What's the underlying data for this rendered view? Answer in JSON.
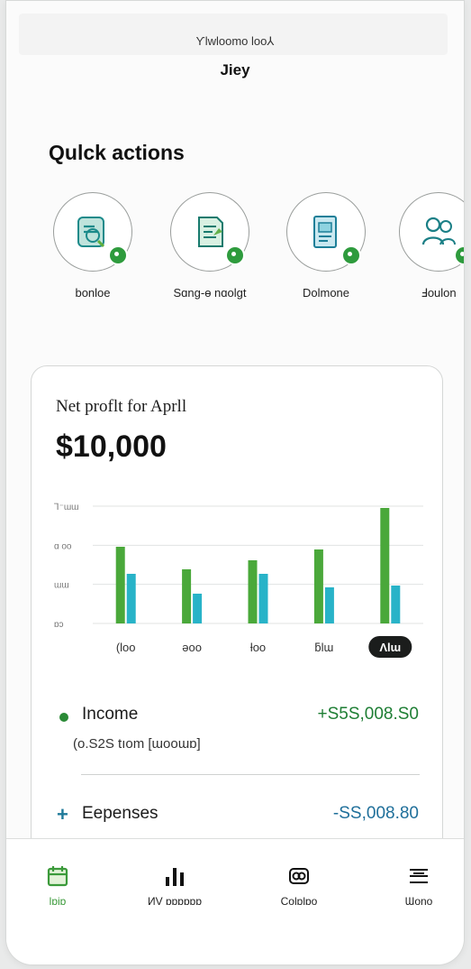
{
  "header": {
    "welcome": "Ƴlwloomo loo⅄",
    "user_name": "Jiey"
  },
  "quick_actions": {
    "title": "Qulck actions",
    "items": [
      {
        "label": "bonloe",
        "icon": "invoice-scan-icon"
      },
      {
        "label": "Sɑng-ɵ nɑolgt",
        "icon": "receipt-icon"
      },
      {
        "label": "Dolmone",
        "icon": "document-icon"
      },
      {
        "label": "Ⅎoulon",
        "icon": "contacts-icon"
      }
    ]
  },
  "profit_card": {
    "title": "Net proflt for Aprll",
    "amount": "$10,000",
    "chart_data": {
      "type": "bar",
      "categories": [
        "(loo",
        "ǝoo",
        "ƚoo",
        "ƃlɯ",
        "Λlɯ"
      ],
      "selected_category": "Λlɯ",
      "y_tick_labels": [
        "Ꞁ⁻ɯɯ",
        "ɑ oo",
        "ɯɯ",
        "ɒɔ"
      ],
      "series": [
        {
          "values": [
            85,
            60,
            70,
            82,
            128
          ]
        },
        {
          "values": [
            55,
            33,
            55,
            40,
            42
          ]
        }
      ],
      "ylim": [
        0,
        130
      ],
      "grid": true,
      "colors": [
        "#4aa83a",
        "#28b3c8"
      ]
    },
    "income": {
      "label": "Income",
      "value": "+S5S,008.S0",
      "note": "(o.S2S tıom [ɯooɯɒ]"
    },
    "expenses": {
      "label": "Eepenses",
      "value": "-SS,008.80"
    }
  },
  "bottom_nav": [
    {
      "label": "lɒiɒ",
      "icon": "calendar-home-icon",
      "active": true
    },
    {
      "label": "ИV ɒɒɒɒɒɒ",
      "icon": "bar-chart-icon",
      "active": false
    },
    {
      "label": "Colɒlɒo",
      "icon": "card-icon",
      "active": false
    },
    {
      "label": "Ɯono",
      "icon": "menu-icon",
      "active": false
    }
  ],
  "colors": {
    "accent_green": "#2e9b3d",
    "income_green": "#1e7e34",
    "expense_blue": "#1f6f9a"
  }
}
